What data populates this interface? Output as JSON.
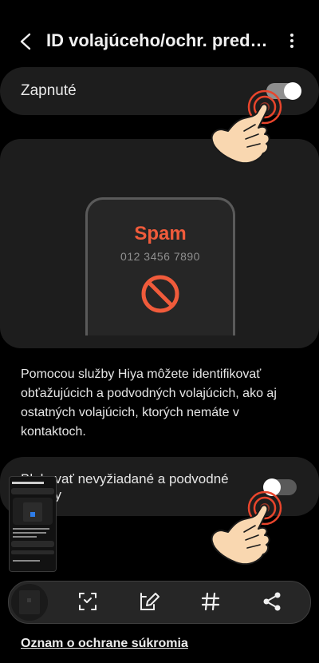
{
  "header": {
    "title": "ID volajúceho/ochr. pred…"
  },
  "main_switch": {
    "label": "Zapnuté",
    "on": true
  },
  "illustration": {
    "spam_label": "Spam",
    "phone_number": "012 3456 7890"
  },
  "description": "Pomocou služby Hiya môžete identifikovať obťažujúcich a podvodných volajúcich, ako aj ostatných volajúcich, ktorých nemáte v kontaktoch.",
  "block_switch": {
    "label": "Blokovať nevyžiadané a podvodné hovory",
    "on": false
  },
  "toolbar": {
    "items": [
      "crop-icon",
      "edit-icon",
      "hashtag-icon",
      "share-icon"
    ]
  },
  "footer": {
    "privacy_link": "Oznam o ochrane súkromia"
  },
  "colors": {
    "accent": "#f05b3b",
    "card_bg": "#1d1d1d",
    "background": "#000000"
  }
}
